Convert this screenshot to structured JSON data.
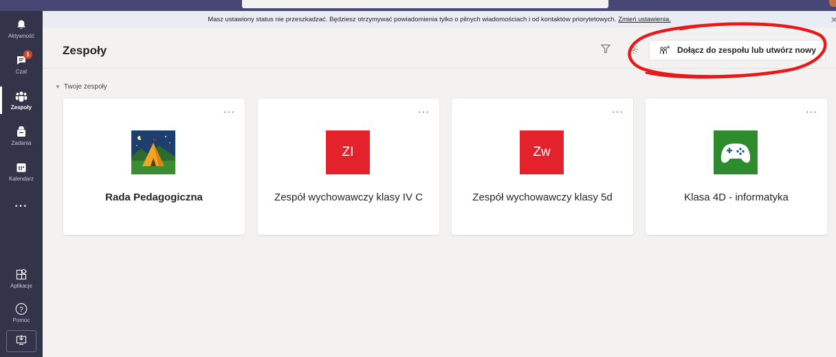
{
  "banner": {
    "text": "Masz ustawiony status nie przeszkadzać. Będziesz otrzymywać powiadomienia tylko o pilnych wiadomościach i od kontaktów priorytetowych.",
    "link": "Zmień ustawienia."
  },
  "rail": {
    "items": [
      {
        "label": "Aktywność",
        "icon": "bell-icon"
      },
      {
        "label": "Czat",
        "icon": "chat-icon",
        "badge": "1"
      },
      {
        "label": "Zespoły",
        "icon": "teams-icon",
        "active": true
      },
      {
        "label": "Zadania",
        "icon": "assignments-icon"
      },
      {
        "label": "Kalendarz",
        "icon": "calendar-icon"
      }
    ],
    "more": "···",
    "apps_label": "Aplikacje",
    "help_label": "Pomoc"
  },
  "header": {
    "title": "Zespoły",
    "join_button": "Dołącz do zespołu lub utwórz nowy"
  },
  "section": {
    "label": "Twoje zespoły"
  },
  "teams": [
    {
      "name": "Rada Pedagogiczna",
      "logo": "camping-tent-image"
    },
    {
      "name": "Zespół wychowawczy klasy IV C",
      "initials": "ZI",
      "color": "#e3222c"
    },
    {
      "name": "Zespół wychowawczy klasy 5d",
      "initials": "Zw",
      "color": "#e3222c"
    },
    {
      "name": "Klasa 4D - informatyka",
      "logo": "gamepad-image",
      "color": "#2e8b2e"
    }
  ],
  "card_more": "···",
  "colors": {
    "rail": "#33344a",
    "titlebar": "#464775",
    "banner": "#e9ebf5",
    "annotation": "#e8191b"
  }
}
